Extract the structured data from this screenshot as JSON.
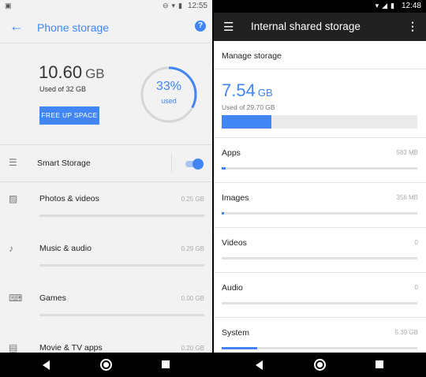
{
  "left": {
    "status_time": "12:55",
    "title": "Phone storage",
    "used_value": "10.60",
    "used_unit": "GB",
    "used_of": "Used of 32 GB",
    "free_up_label": "FREE UP SPACE",
    "percent_label": "33%",
    "percent_sub": "used",
    "percent_value": 0.33,
    "smart_storage_label": "Smart Storage",
    "smart_storage_on": true,
    "categories": [
      {
        "label": "Photos & videos",
        "size": "0.25 GB",
        "icon": "photo-icon"
      },
      {
        "label": "Music & audio",
        "size": "0.29 GB",
        "icon": "music-note-icon"
      },
      {
        "label": "Games",
        "size": "0.00 GB",
        "icon": "gamepad-icon"
      },
      {
        "label": "Movie & TV apps",
        "size": "0.20 GB",
        "icon": "movie-icon"
      }
    ]
  },
  "right": {
    "status_time": "12:48",
    "title": "Internal shared storage",
    "manage_label": "Manage storage",
    "used_value": "7.54",
    "used_unit": "GB",
    "used_of": "Used of 29.70 GB",
    "used_fraction": 0.254,
    "categories": [
      {
        "label": "Apps",
        "size": "583 MB",
        "fraction": 0.02
      },
      {
        "label": "Images",
        "size": "356 MB",
        "fraction": 0.012
      },
      {
        "label": "Videos",
        "size": "0",
        "fraction": 0
      },
      {
        "label": "Audio",
        "size": "0",
        "fraction": 0
      },
      {
        "label": "System",
        "size": "5.39 GB",
        "fraction": 0.18
      }
    ]
  },
  "colors": {
    "accent": "#4285f4"
  }
}
